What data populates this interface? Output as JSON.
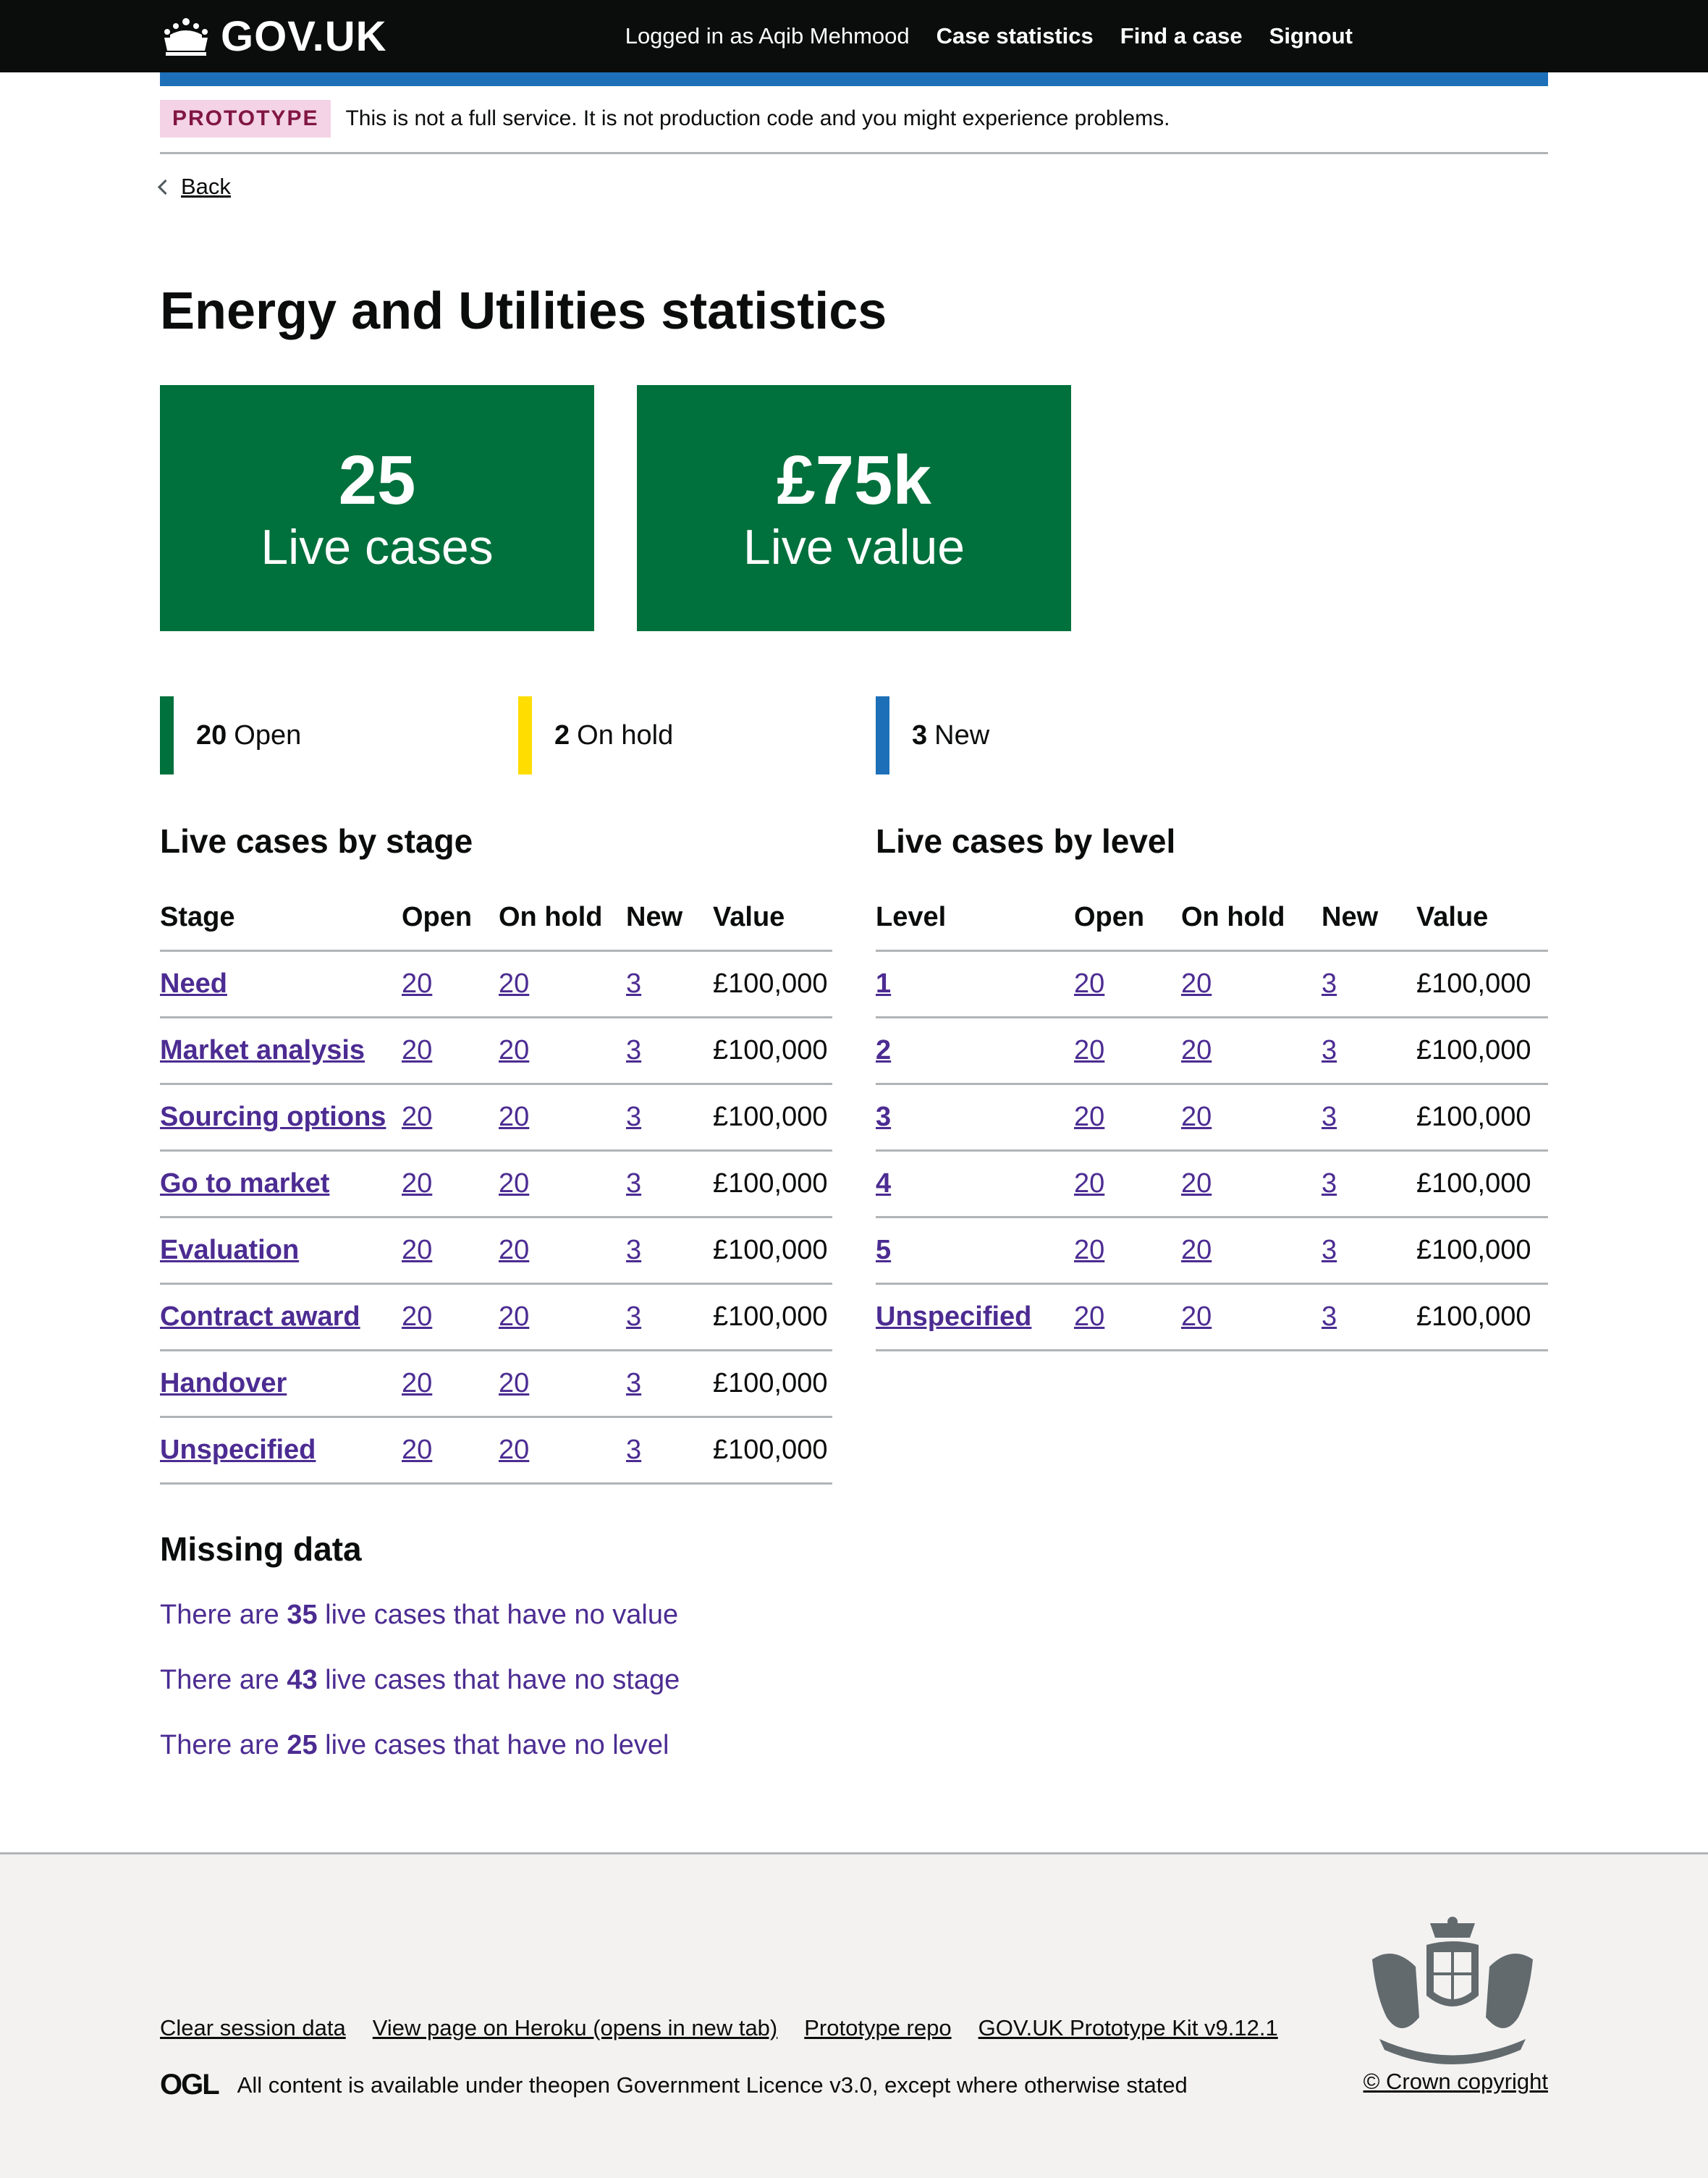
{
  "header": {
    "logo_text": "GOV.UK",
    "logged_in": "Logged in as Aqib Mehmood",
    "nav": [
      "Case statistics",
      "Find a case",
      "Signout"
    ]
  },
  "phase": {
    "tag": "PROTOTYPE",
    "text": "This is not a full service. It is not production code and you might experience problems."
  },
  "back_label": "Back",
  "title": "Energy and Utilities statistics",
  "stats": [
    {
      "value": "25",
      "label": "Live cases"
    },
    {
      "value": "£75k",
      "label": "Live value"
    }
  ],
  "status": [
    {
      "count": "20",
      "label": "Open",
      "color": "#00703c"
    },
    {
      "count": "2",
      "label": "On hold",
      "color": "#ffdd00"
    },
    {
      "count": "3",
      "label": "New",
      "color": "#1d70b8"
    }
  ],
  "stage_table": {
    "heading": "Live cases by stage",
    "columns": [
      "Stage",
      "Open",
      "On hold",
      "New",
      "Value"
    ],
    "rows": [
      [
        "Need",
        "20",
        "20",
        "3",
        "£100,000"
      ],
      [
        "Market analysis",
        "20",
        "20",
        "3",
        "£100,000"
      ],
      [
        "Sourcing options",
        "20",
        "20",
        "3",
        "£100,000"
      ],
      [
        "Go to market",
        "20",
        "20",
        "3",
        "£100,000"
      ],
      [
        "Evaluation",
        "20",
        "20",
        "3",
        "£100,000"
      ],
      [
        "Contract award",
        "20",
        "20",
        "3",
        "£100,000"
      ],
      [
        "Handover",
        "20",
        "20",
        "3",
        "£100,000"
      ],
      [
        "Unspecified",
        "20",
        "20",
        "3",
        "£100,000"
      ]
    ]
  },
  "level_table": {
    "heading": "Live cases by level",
    "columns": [
      "Level",
      "Open",
      "On hold",
      "New",
      "Value"
    ],
    "rows": [
      [
        "1",
        "20",
        "20",
        "3",
        "£100,000"
      ],
      [
        "2",
        "20",
        "20",
        "3",
        "£100,000"
      ],
      [
        "3",
        "20",
        "20",
        "3",
        "£100,000"
      ],
      [
        "4",
        "20",
        "20",
        "3",
        "£100,000"
      ],
      [
        "5",
        "20",
        "20",
        "3",
        "£100,000"
      ],
      [
        "Unspecified",
        "20",
        "20",
        "3",
        "£100,000"
      ]
    ]
  },
  "missing": {
    "heading": "Missing data",
    "links": [
      {
        "pre": "There are ",
        "count": "35",
        "post": " live cases that have no value"
      },
      {
        "pre": "There are ",
        "count": "43",
        "post": " live cases that have no stage"
      },
      {
        "pre": "There are ",
        "count": "25",
        "post": " live cases that have no level"
      }
    ]
  },
  "footer": {
    "links": [
      "Clear session data",
      "View page on Heroku (opens in new tab)",
      "Prototype repo",
      "GOV.UK Prototype Kit v9.12.1"
    ],
    "ogl": "OGL",
    "licence_pre": "All content is available under the ",
    "licence_link": "open Government Licence v3.0",
    "licence_post": ", except where otherwise stated",
    "copyright": "© Crown copyright"
  }
}
